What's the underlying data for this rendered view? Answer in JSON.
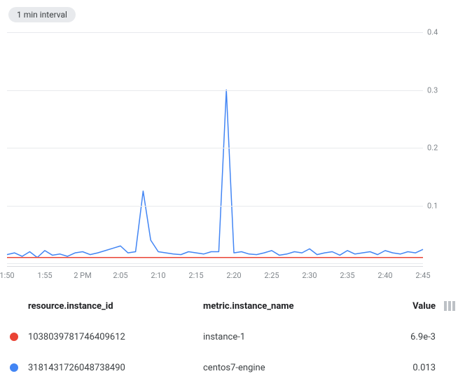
{
  "header": {
    "interval_label": "1 min interval"
  },
  "chart_data": {
    "type": "line",
    "x_categories": [
      "1:50",
      "1:55",
      "2 PM",
      "2:05",
      "2:10",
      "2:15",
      "2:20",
      "2:25",
      "2:30",
      "2:35",
      "2:40",
      "2:45"
    ],
    "ylim": [
      0,
      0.4
    ],
    "y_ticks": [
      0,
      0.1,
      0.2,
      0.3,
      0.4
    ],
    "xlabel": "",
    "ylabel": "",
    "series": [
      {
        "name": "centos7-engine",
        "color": "#4285f4",
        "values_per_minute": [
          0.015,
          0.018,
          0.012,
          0.02,
          0.01,
          0.022,
          0.014,
          0.016,
          0.012,
          0.018,
          0.02,
          0.015,
          0.018,
          0.022,
          0.026,
          0.03,
          0.018,
          0.02,
          0.125,
          0.04,
          0.02,
          0.018,
          0.016,
          0.015,
          0.02,
          0.018,
          0.016,
          0.02,
          0.02,
          0.3,
          0.018,
          0.02,
          0.016,
          0.015,
          0.018,
          0.022,
          0.014,
          0.016,
          0.02,
          0.018,
          0.025,
          0.015,
          0.018,
          0.02,
          0.014,
          0.022,
          0.016,
          0.018,
          0.02,
          0.015,
          0.022,
          0.018,
          0.016,
          0.02,
          0.018,
          0.024
        ]
      },
      {
        "name": "instance-1",
        "color": "#ea4335",
        "values_per_minute": [
          0.01,
          0.01,
          0.01,
          0.01,
          0.01,
          0.01,
          0.01,
          0.01,
          0.01,
          0.01,
          0.01,
          0.01,
          0.01,
          0.01,
          0.01,
          0.01,
          0.01,
          0.01,
          0.01,
          0.01,
          0.01,
          0.01,
          0.01,
          0.01,
          0.01,
          0.01,
          0.01,
          0.01,
          0.01,
          0.01,
          0.01,
          0.01,
          0.01,
          0.01,
          0.01,
          0.01,
          0.01,
          0.01,
          0.01,
          0.01,
          0.01,
          0.01,
          0.01,
          0.01,
          0.01,
          0.01,
          0.01,
          0.01,
          0.01,
          0.01,
          0.01,
          0.01,
          0.01,
          0.01,
          0.01,
          0.01
        ]
      }
    ]
  },
  "legend": {
    "columns": {
      "instance_id": "resource.instance_id",
      "instance_name": "metric.instance_name",
      "value": "Value"
    },
    "rows": [
      {
        "color": "#ea4335",
        "instance_id": "1038039781746409612",
        "instance_name": "instance-1",
        "value": "6.9e-3"
      },
      {
        "color": "#4285f4",
        "instance_id": "3181431726048738490",
        "instance_name": "centos7-engine",
        "value": "0.013"
      }
    ]
  }
}
